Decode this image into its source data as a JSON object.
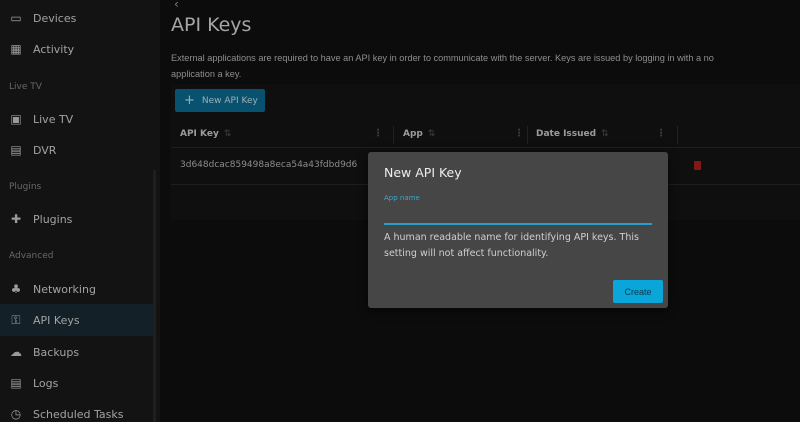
{
  "sidebar": {
    "items": [
      {
        "label": "Devices",
        "icon": "devices-icon"
      },
      {
        "label": "Activity",
        "icon": "activity-icon"
      },
      {
        "label": "Live TV",
        "icon": "live-tv-icon"
      },
      {
        "label": "DVR",
        "icon": "dvr-icon"
      },
      {
        "label": "Plugins",
        "icon": "plugins-icon"
      },
      {
        "label": "Networking",
        "icon": "networking-icon"
      },
      {
        "label": "API Keys",
        "icon": "key-icon",
        "active": true
      },
      {
        "label": "Backups",
        "icon": "cloud-upload-icon"
      },
      {
        "label": "Logs",
        "icon": "logs-icon"
      },
      {
        "label": "Scheduled Tasks",
        "icon": "clock-icon"
      }
    ],
    "headings": [
      "Live TV",
      "Plugins",
      "Advanced"
    ]
  },
  "page": {
    "title": "API Keys",
    "description_line1": "External applications are required to have an API key in order to communicate with the server. Keys are issued by logging in with a no",
    "description_line2": "application a key.",
    "new_button": "New API Key",
    "columns": [
      "API Key",
      "App",
      "Date Issued"
    ],
    "rows": [
      {
        "api_key": "3d648dcac859498a8eca54a43fdbd9d6"
      }
    ]
  },
  "dialog": {
    "title": "New API Key",
    "field_label": "App name",
    "field_value": "",
    "help": "A human readable name for identifying API keys. This setting will not affect functionality.",
    "create": "Create"
  },
  "colors": {
    "accent": "#0aa5d9",
    "primary_button": "#0b6e94",
    "delete": "#b0201c",
    "active_item": "#1a2b36"
  }
}
